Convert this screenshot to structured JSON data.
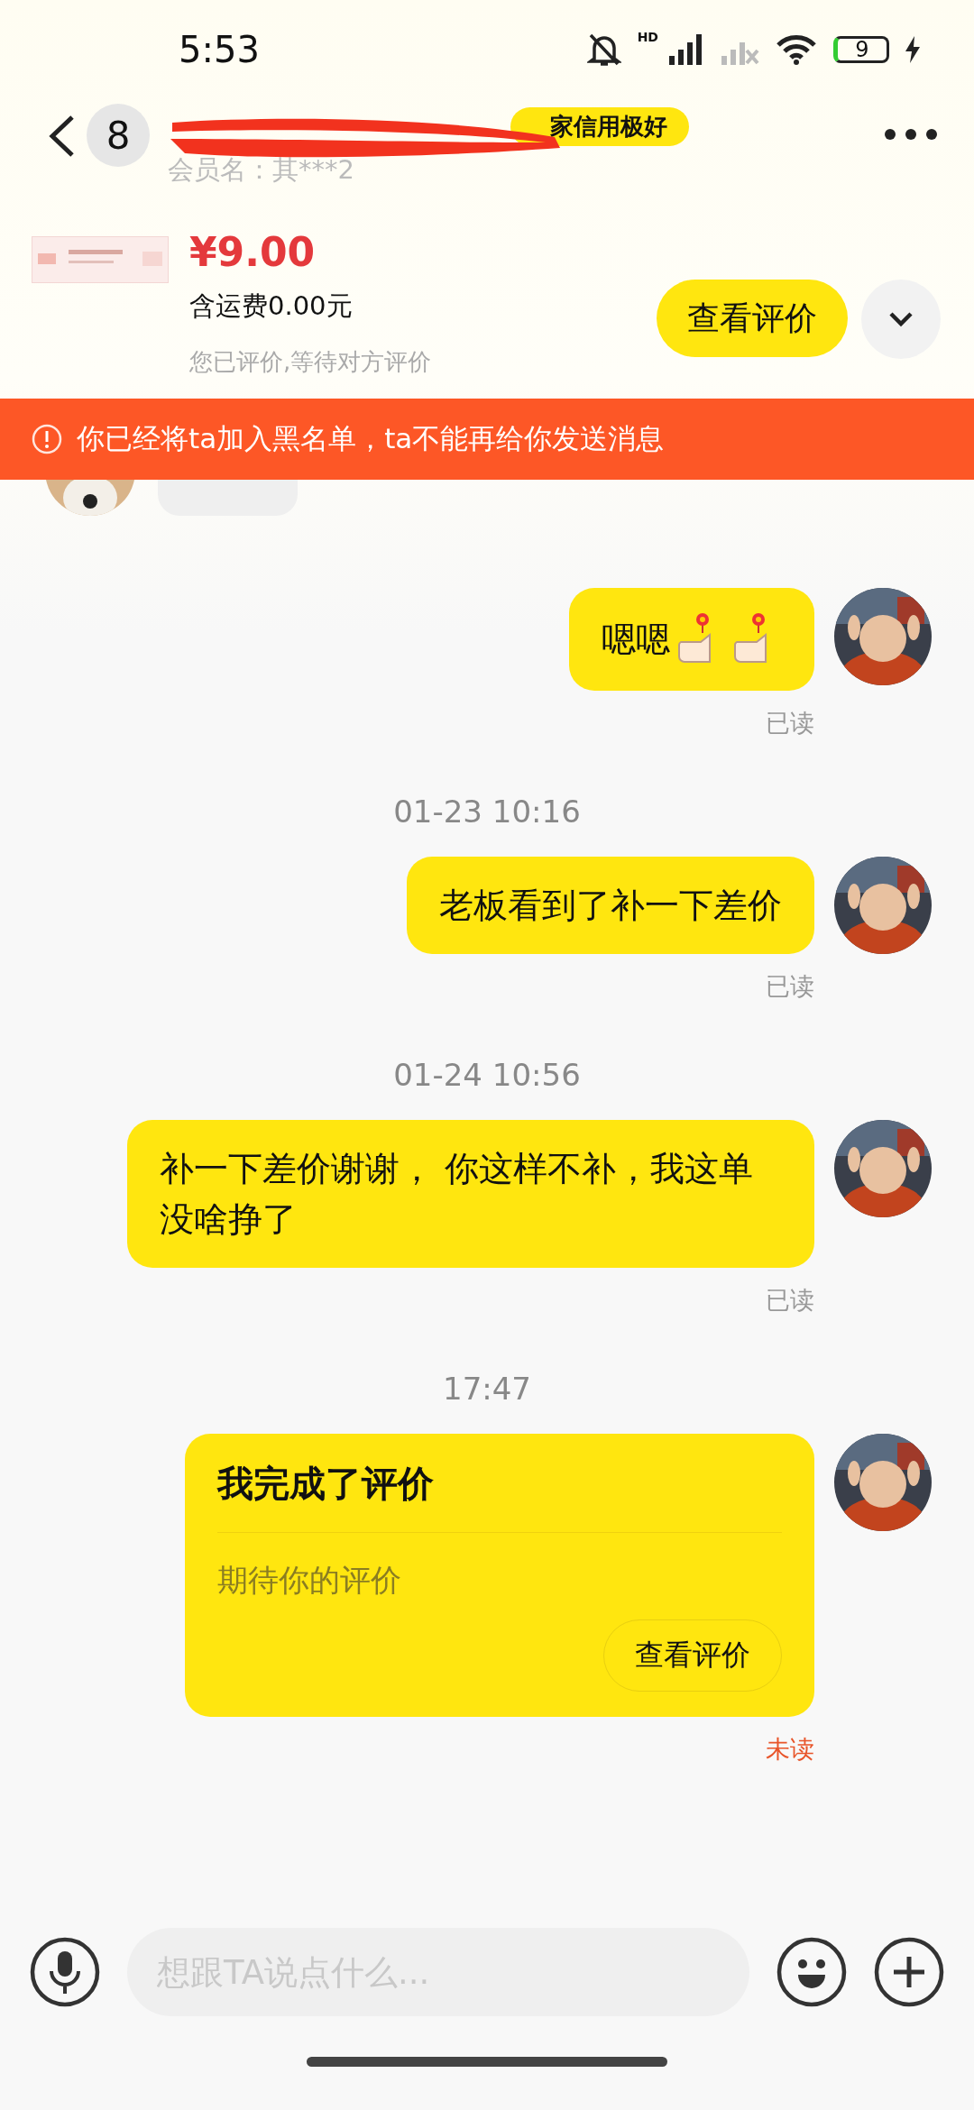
{
  "status_bar": {
    "time": "5:53",
    "network": "HD",
    "battery": "9"
  },
  "header": {
    "unread_count": "8",
    "credit_badge": "家信用极好",
    "member_name": "会员名：其***2"
  },
  "order": {
    "price": "¥9.00",
    "shipping": "含运费0.00元",
    "status": "您已评价,等待对方评价",
    "button": "查看评价"
  },
  "banner": {
    "text": "你已经将ta加入黑名单，ta不能再给你发送消息"
  },
  "messages": [
    {
      "kind": "partial",
      "outgoing": false
    },
    {
      "kind": "text",
      "outgoing": true,
      "text": "嗯嗯",
      "stickers": true,
      "receipt": "已读",
      "read": true
    },
    {
      "kind": "time",
      "text": "01-23 10:16"
    },
    {
      "kind": "text",
      "outgoing": true,
      "text": "老板看到了补一下差价",
      "stickers": false,
      "receipt": "已读",
      "read": true
    },
    {
      "kind": "time",
      "text": "01-24 10:56"
    },
    {
      "kind": "text",
      "outgoing": true,
      "text": "补一下差价谢谢， 你这样不补，我这单没啥挣了",
      "stickers": false,
      "receipt": "已读",
      "read": true
    },
    {
      "kind": "time",
      "text": "17:47"
    },
    {
      "kind": "card",
      "outgoing": true,
      "title": "我完成了评价",
      "text": "期待你的评价",
      "button": "查看评价",
      "receipt": "未读",
      "read": false
    }
  ],
  "input": {
    "placeholder": "想跟TA说点什么..."
  }
}
